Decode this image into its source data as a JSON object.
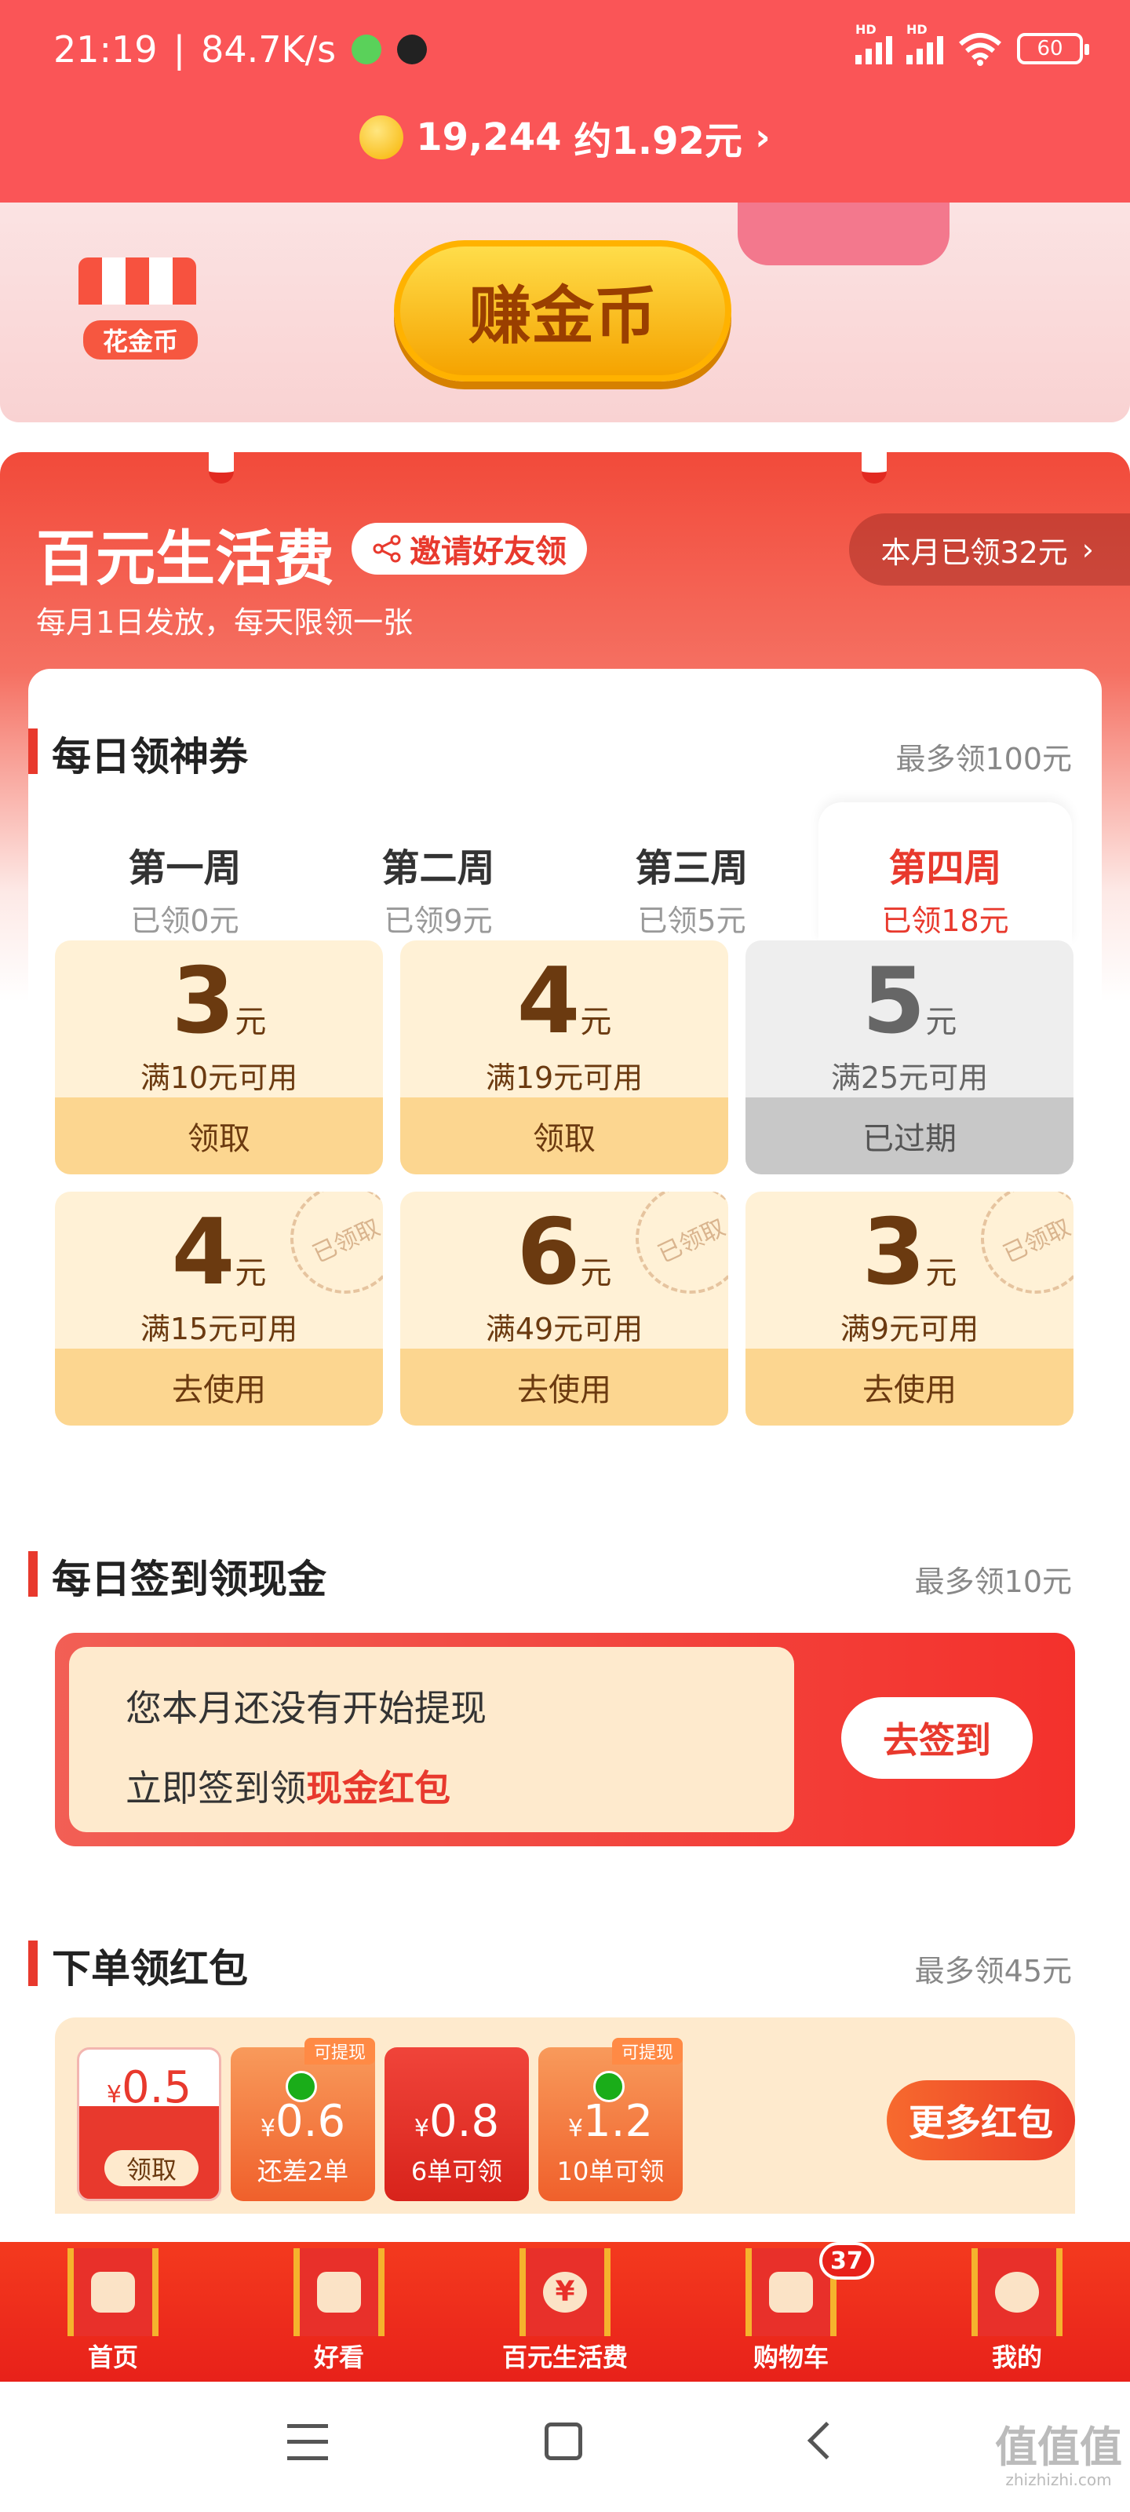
{
  "status": {
    "time": "21:19",
    "speed": "84.7K/s",
    "battery": "60",
    "hd": "HD"
  },
  "header": {
    "coins": "19,244",
    "approx": "约1.92元",
    "chevron": "›"
  },
  "banner": {
    "shop_label": "花金币",
    "earn_label": "赚金币"
  },
  "hero": {
    "title": "百元生活费",
    "invite": "邀请好友领",
    "subtitle": "每月1日发放，每天限领一张",
    "month_claimed": "本月已领32元",
    "chevron": "›"
  },
  "coupons_section": {
    "title": "每日领神券",
    "max": "最多领100元",
    "weeks": [
      {
        "name": "第一周",
        "got": "已领0元"
      },
      {
        "name": "第二周",
        "got": "已领9元"
      },
      {
        "name": "第三周",
        "got": "已领5元"
      },
      {
        "name": "第四周",
        "got": "已领18元"
      }
    ],
    "unit": "元",
    "stamp": "已领取",
    "items": [
      {
        "amount": "3",
        "cond": "满10元可用",
        "action": "领取"
      },
      {
        "amount": "4",
        "cond": "满19元可用",
        "action": "领取"
      },
      {
        "amount": "5",
        "cond": "满25元可用",
        "action": "已过期"
      },
      {
        "amount": "4",
        "cond": "满15元可用",
        "action": "去使用"
      },
      {
        "amount": "6",
        "cond": "满49元可用",
        "action": "去使用"
      },
      {
        "amount": "3",
        "cond": "满9元可用",
        "action": "去使用"
      }
    ]
  },
  "checkin_section": {
    "title": "每日签到领现金",
    "max": "最多领10元",
    "line1": "您本月还没有开始提现",
    "line2_prefix": "立即签到领",
    "line2_highlight": "现金红包",
    "button": "去签到"
  },
  "order_section": {
    "title": "下单领红包",
    "max": "最多领45元",
    "packets": [
      {
        "value": "0.5",
        "sub": "领取",
        "tag": ""
      },
      {
        "value": "0.6",
        "sub": "还差2单",
        "tag": "可提现"
      },
      {
        "value": "0.8",
        "sub": "6单可领",
        "tag": ""
      },
      {
        "value": "1.2",
        "sub": "10单可领",
        "tag": "可提现"
      }
    ],
    "currency": "¥",
    "more": "更多红包"
  },
  "tabs": [
    {
      "label": "首页",
      "icon": "home-icon"
    },
    {
      "label": "好看",
      "icon": "video-icon"
    },
    {
      "label": "百元生活费",
      "icon": "yuan-icon"
    },
    {
      "label": "购物车",
      "icon": "cart-icon",
      "badge": "37"
    },
    {
      "label": "我的",
      "icon": "profile-icon"
    }
  ],
  "tab_yuan_glyph": "¥",
  "watermark": {
    "main": "值值值",
    "sub": "zhizhizhi.com"
  }
}
